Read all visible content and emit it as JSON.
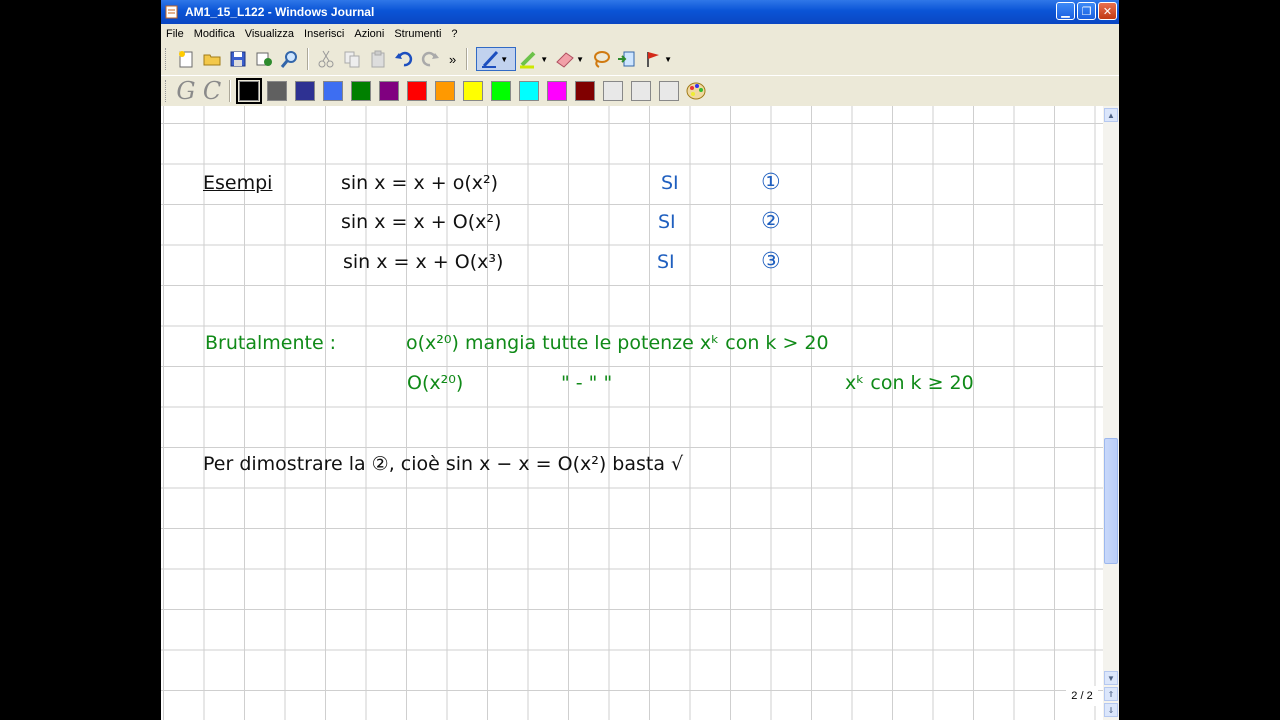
{
  "window": {
    "title": "AM1_15_L122 - Windows Journal"
  },
  "menu": [
    "File",
    "Modifica",
    "Visualizza",
    "Inserisci",
    "Azioni",
    "Strumenti",
    "?"
  ],
  "toolbar": {
    "overflow_label": "»",
    "pen_colors": [
      "#000000",
      "#606060",
      "#2e3192",
      "#3d6ef2",
      "#008000",
      "#800080",
      "#ff0000",
      "#ff9900",
      "#ffff00",
      "#00ff00",
      "#00ffff",
      "#ff00ff",
      "#800000",
      "#e8e8e8",
      "#e8e8e8",
      "#e8e8e8"
    ],
    "selected_color": "#000000"
  },
  "note": {
    "examples_label": "Esempi",
    "examples": [
      {
        "formula": "sin x = x + o(x²)",
        "answer": "SI",
        "marker": "①"
      },
      {
        "formula": "sin x = x + O(x²)",
        "answer": "SI",
        "marker": "②"
      },
      {
        "formula": "sin x = x + O(x³)",
        "answer": "SI",
        "marker": "③"
      }
    ],
    "brutal_label": "Brutalmente :",
    "brutal_line1": "o(x²⁰) mangia tutte le potenze xᵏ con k > 20",
    "brutal_line2_head": "O(x²⁰)",
    "brutal_line2_ditto": "\"     -     \"     \"",
    "brutal_line2_tail": "xᵏ con k ≥ 20",
    "proof_line": "Per dimostrare la ②, cioè   sin x − x = O(x²) basta √"
  },
  "status": {
    "page_indicator": "2 / 2"
  }
}
